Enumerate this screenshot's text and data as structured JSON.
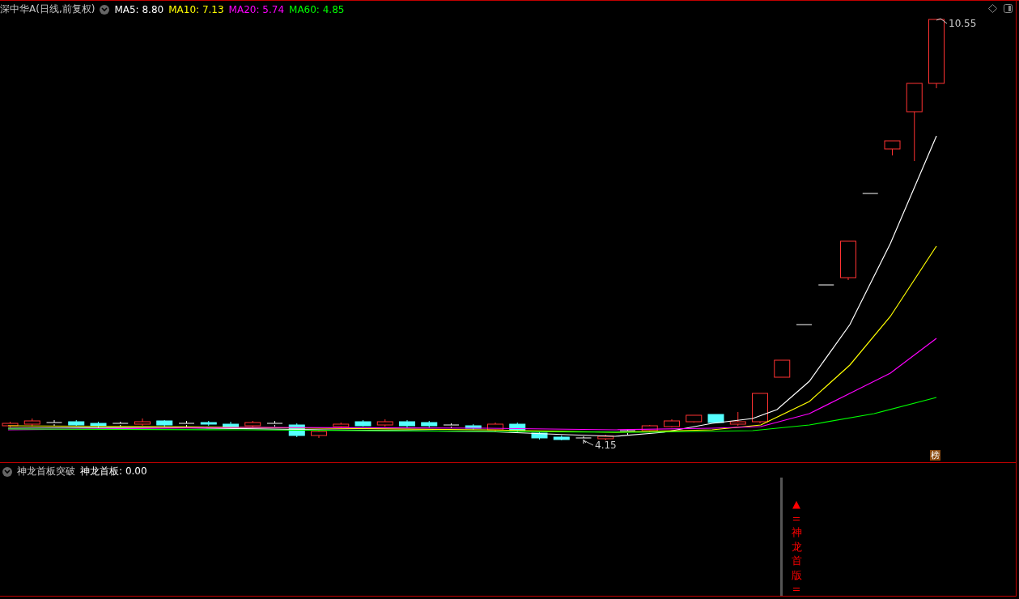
{
  "header": {
    "title": "深中华A(日线,前复权)",
    "averages": [
      {
        "label": "MA5:",
        "value": "8.80",
        "color": "#ffffff"
      },
      {
        "label": "MA10:",
        "value": "7.13",
        "color": "#ffff00"
      },
      {
        "label": "MA20:",
        "value": "5.74",
        "color": "#ff00ff"
      },
      {
        "label": "MA60:",
        "value": "4.85",
        "color": "#00ff00"
      }
    ]
  },
  "price_labels": {
    "high": "10.55",
    "low": "4.15"
  },
  "badge": "榜",
  "indicator": {
    "name": "神龙首板突破",
    "reading_label": "神龙首板:",
    "reading_value": "0.00",
    "signal": {
      "marker": "▲",
      "top": "=",
      "text": "神龙首版",
      "bottom": "="
    }
  }
}
